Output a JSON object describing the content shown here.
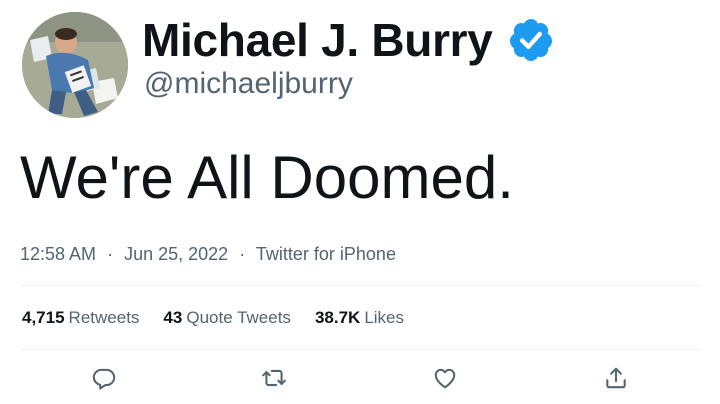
{
  "author": {
    "display_name": "Michael J. Burry",
    "handle": "@michaeljburry",
    "verified": true,
    "verified_color": "#1d9bf0"
  },
  "tweet": {
    "text": "We're All Doomed."
  },
  "meta": {
    "time": "12:58 AM",
    "separator": "·",
    "date": "Jun 25, 2022",
    "source": "Twitter for iPhone"
  },
  "stats": {
    "retweets_count": "4,715",
    "retweets_label": "Retweets",
    "quotes_count": "43",
    "quotes_label": "Quote Tweets",
    "likes_count": "38.7K",
    "likes_label": "Likes"
  },
  "actions": [
    {
      "icon": "reply-icon"
    },
    {
      "icon": "retweet-icon"
    },
    {
      "icon": "like-icon"
    },
    {
      "icon": "share-icon"
    }
  ],
  "colors": {
    "text": "#0f1419",
    "secondary": "#536471",
    "divider": "#eff3f4"
  }
}
